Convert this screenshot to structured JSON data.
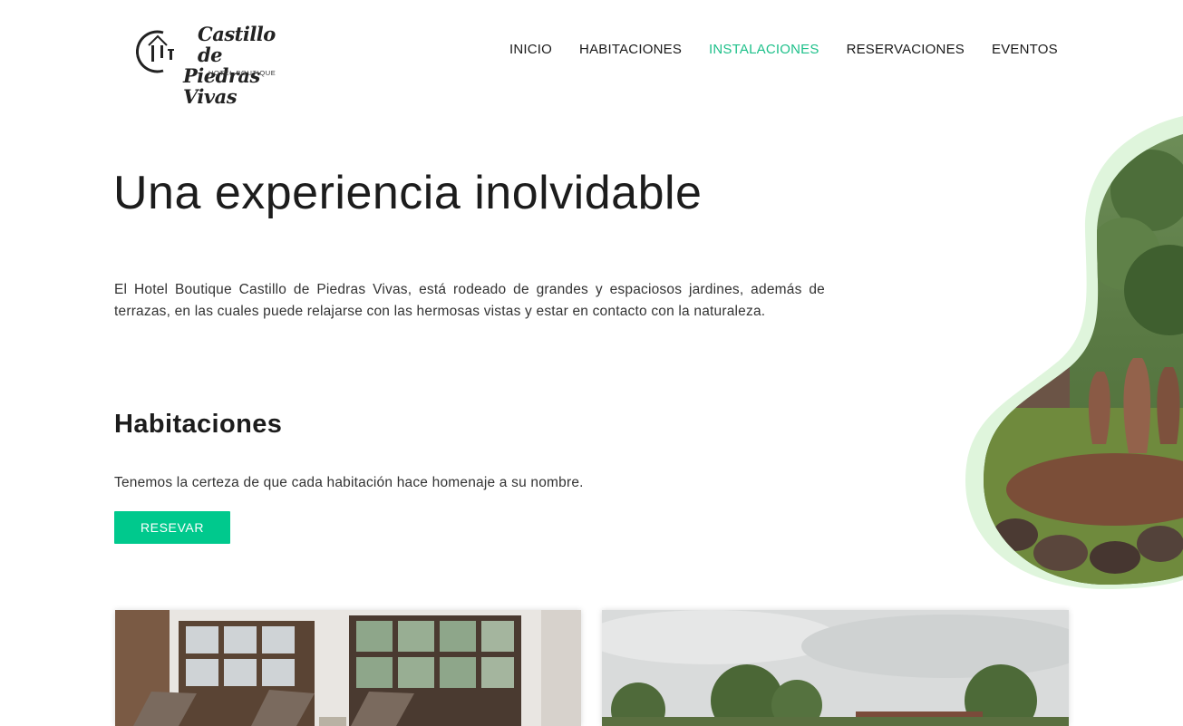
{
  "brand": {
    "name_line1": "Castillo de",
    "name_line2": "Piedras Vivas",
    "subtitle": "HOTEL BOUTIQUE"
  },
  "nav": {
    "items": [
      {
        "label": "INICIO"
      },
      {
        "label": "HABITACIONES"
      },
      {
        "label": "INSTALACIONES"
      },
      {
        "label": "RESERVACIONES"
      },
      {
        "label": "EVENTOS"
      }
    ],
    "active_index": 2
  },
  "hero": {
    "title": "Una experiencia inolvidable",
    "text": "El Hotel Boutique Castillo de Piedras Vivas, está rodeado de grandes y espaciosos jardines, además de terrazas, en las cuales puede relajarse con las hermosas vistas y estar en contacto con la naturaleza."
  },
  "rooms_section": {
    "title": "Habitaciones",
    "text": "Tenemos la certeza de que cada habitación hace homenaje a su nombre.",
    "button_label": "RESEVAR"
  },
  "colors": {
    "accent": "#00c98d",
    "active_nav": "#1ec08a",
    "blob_outline": "#dff5dc"
  }
}
